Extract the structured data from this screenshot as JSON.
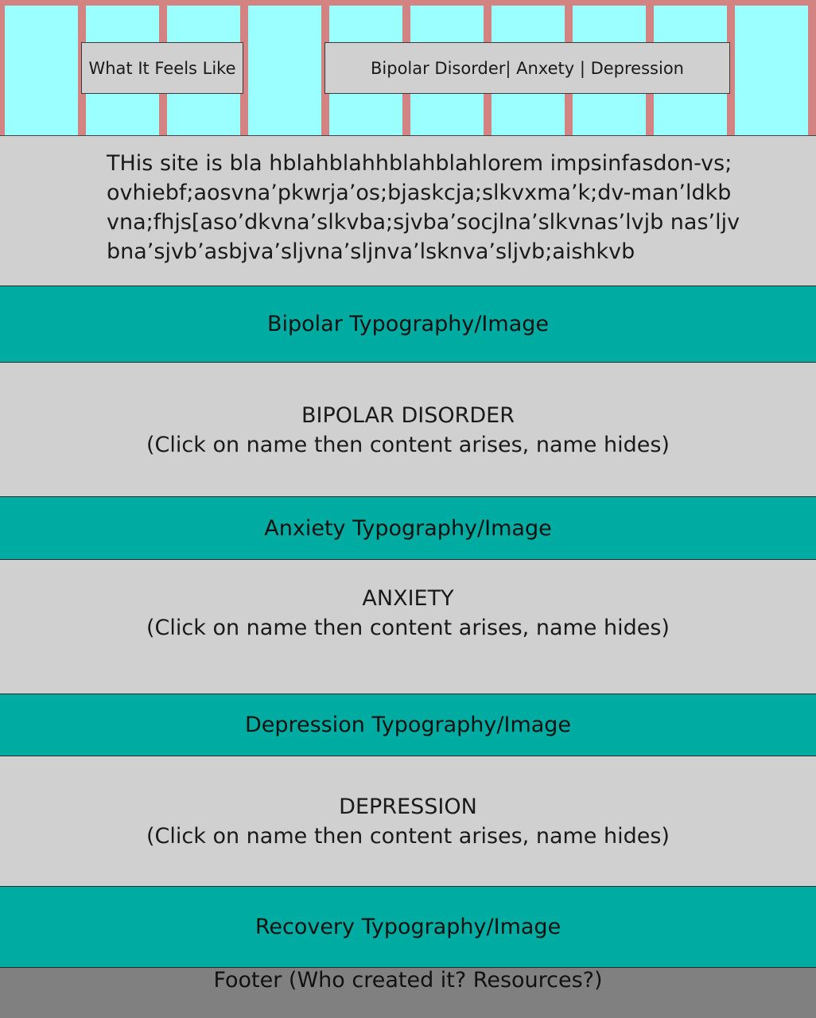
{
  "nav": {
    "what_it_feels_like": "What It Feels Like",
    "conditions": "Bipolar Disorder| Anxety | Depression"
  },
  "intro": {
    "text": "THis site is bla hblahblahhblahblahlorem impsinfasdon-vs;ovhiebf;aosvna’pkwrja’os;bjaskcja;slkvxma’k;dv-man’ldkbvna;fhjs[aso’dkvna’slkvba;sjvba’socjlna’slkvnas’lvjb nas’ljvbna’sjvb’asbjva’sljvna’sljnva’lsknva’sljvb;aishkvb"
  },
  "bipolar": {
    "banner": "Bipolar Typography/Image",
    "title": "BIPOLAR DISORDER",
    "note": "(Click on name then content arises, name hides)"
  },
  "anxiety": {
    "banner": "Anxiety Typography/Image",
    "title": "ANXIETY",
    "note": "(Click on name then content arises, name hides)"
  },
  "depression": {
    "banner": "Depression Typography/Image",
    "title": "DEPRESSION",
    "note": "(Click on name then content arises, name hides)"
  },
  "recovery": {
    "banner": "Recovery Typography/Image"
  },
  "footer": {
    "text": "Footer (Who created it? Resources?)"
  },
  "colors": {
    "grid_gutter": "#d48383",
    "grid_column": "#9bffff",
    "panel_gray": "#d0d0d0",
    "banner_teal": "#00aca1",
    "footer_gray": "#808080"
  }
}
